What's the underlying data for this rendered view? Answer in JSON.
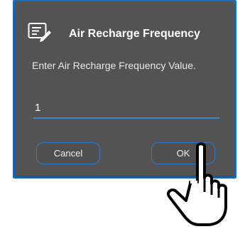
{
  "dialog": {
    "title": "Air Recharge Frequency",
    "message": "Enter Air Recharge Frequency Value.",
    "input_value": "1",
    "cancel_label": "Cancel",
    "ok_label": "OK",
    "icon": "edit-list-icon"
  },
  "pointer": {
    "icon": "hand-pointer-icon"
  },
  "colors": {
    "dialog_background": "#535353",
    "accent": "#2f77c4",
    "frame": "#1d6fc0"
  }
}
